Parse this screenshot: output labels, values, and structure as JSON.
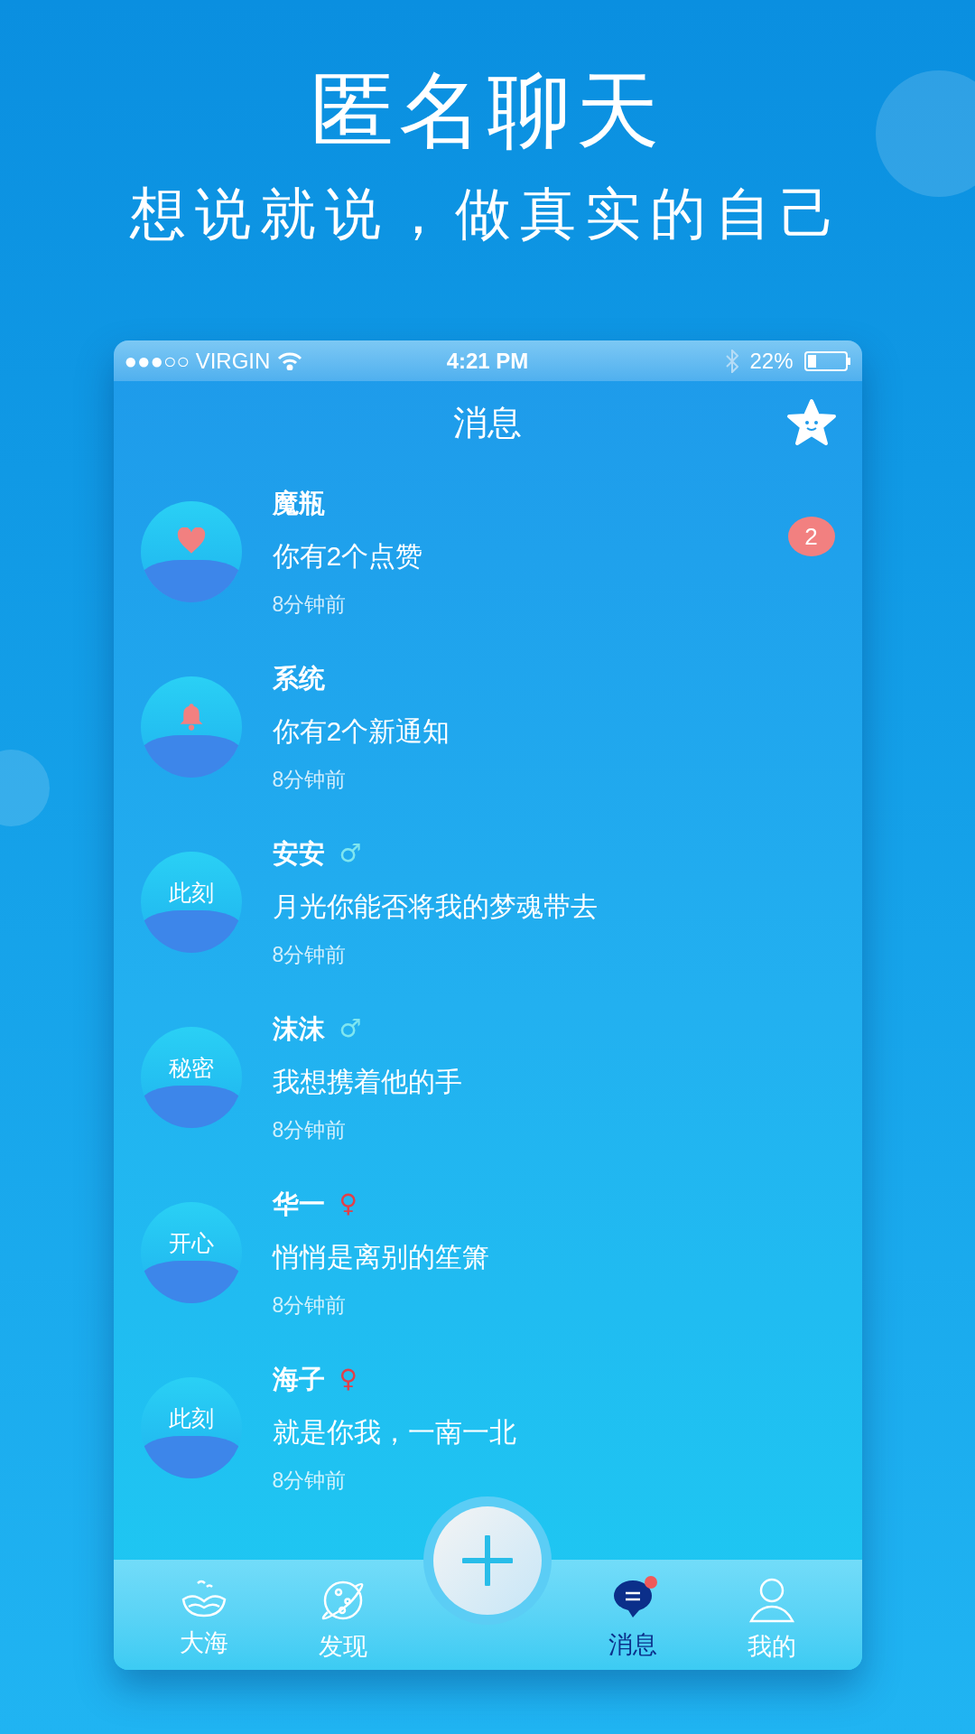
{
  "headline": {
    "title": "匿名聊天",
    "subtitle": "想说就说，做真实的自己"
  },
  "status_bar": {
    "carrier": "●●●○○ VIRGIN",
    "time": "4:21 PM",
    "battery": "22%"
  },
  "header": {
    "title": "消息"
  },
  "messages": [
    {
      "name": "魔瓶",
      "avatar": {
        "kind": "heart"
      },
      "text": "你有2个点赞",
      "time": "8分钟前",
      "badge": "2"
    },
    {
      "name": "系统",
      "avatar": {
        "kind": "bell"
      },
      "text": "你有2个新通知",
      "time": "8分钟前"
    },
    {
      "name": "安安",
      "gender": {
        "sign": "♂",
        "color": "#7fe6f0"
      },
      "avatar": {
        "kind": "label",
        "label": "此刻"
      },
      "text": "月光你能否将我的梦魂带去",
      "time": "8分钟前"
    },
    {
      "name": "沫沫",
      "gender": {
        "sign": "♂",
        "color": "#7fe6f0"
      },
      "avatar": {
        "kind": "label",
        "label": "秘密"
      },
      "text": "我想携着他的手",
      "time": "8分钟前"
    },
    {
      "name": "华一",
      "gender": {
        "sign": "♀",
        "color": "#e0404a"
      },
      "avatar": {
        "kind": "label",
        "label": "开心"
      },
      "text": "悄悄是离别的笙箫",
      "time": "8分钟前"
    },
    {
      "name": "海子",
      "gender": {
        "sign": "♀",
        "color": "#e0404a"
      },
      "avatar": {
        "kind": "label",
        "label": "此刻"
      },
      "text": "就是你我，一南一北",
      "time": "8分钟前"
    }
  ],
  "tab_bar": {
    "tabs": [
      {
        "label": "大海",
        "kind": "sea",
        "selected": false,
        "dot": false
      },
      {
        "label": "发现",
        "kind": "planet",
        "selected": false,
        "dot": false
      },
      {
        "label": "消息",
        "kind": "chat",
        "selected": true,
        "dot": true
      },
      {
        "label": "我的",
        "kind": "person",
        "selected": false,
        "dot": false
      }
    ]
  }
}
